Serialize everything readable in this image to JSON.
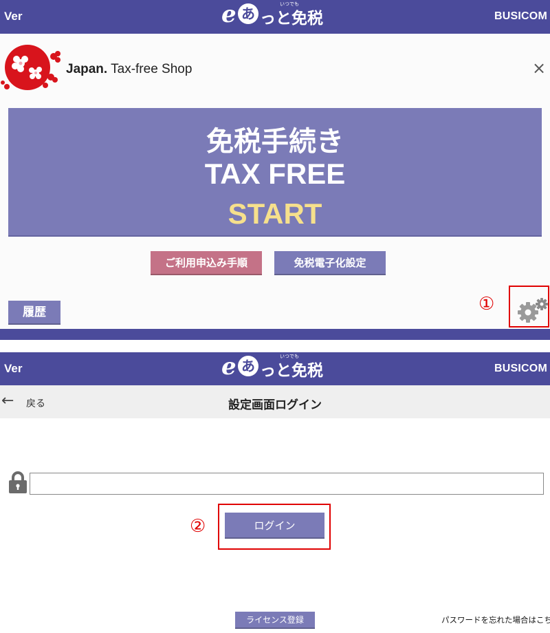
{
  "header": {
    "ver_label": "Ver",
    "logo_e": "e",
    "logo_a": "あ",
    "logo_rest": "っと免税",
    "logo_ruby": "いつでも",
    "brand": "BUSICOM"
  },
  "shop": {
    "japan_bold": "Japan.",
    "japan_rest": " Tax-free Shop",
    "close_symbol": "×"
  },
  "start_button": {
    "jp": "免税手続き",
    "en": "TAX FREE",
    "go": "START"
  },
  "buttons": {
    "apply": "ご利用申込み手順",
    "e_invoice": "免税電子化設定",
    "history": "履歴"
  },
  "annotations": {
    "num1": "①",
    "num2": "②"
  },
  "login_screen": {
    "back_arrow": "←",
    "back_label": "戻る",
    "title": "設定画面ログイン",
    "password_value": "",
    "login_label": "ログイン",
    "license_label": "ライセンス登録",
    "forgot_text": "パスワードを忘れた場合はこちら"
  },
  "colors": {
    "header": "#4b4b9b",
    "button": "#7b7bb7",
    "apply_button": "#c47287",
    "start_text": "#f6e08c",
    "annotation_red": "#e00000"
  },
  "icons": {
    "settings": "gear-icon",
    "lock": "lock-icon",
    "back": "arrow-left-icon",
    "close": "close-icon",
    "flag": "japan-sakura-flag-icon"
  }
}
